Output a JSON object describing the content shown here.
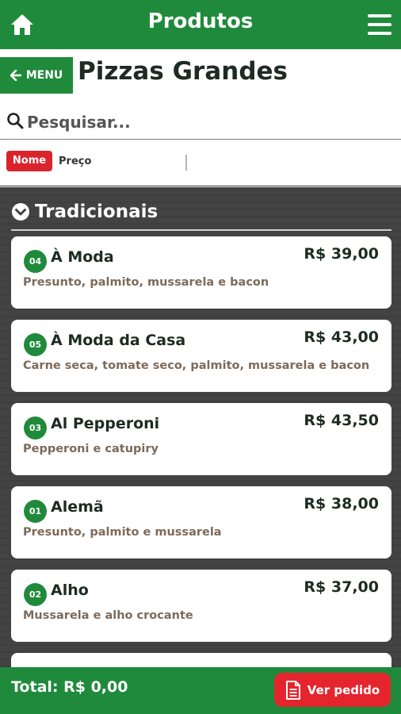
{
  "header": {
    "title": "Produtos",
    "home_icon": "home-icon",
    "menu_icon": "hamburger-menu-icon"
  },
  "nav": {
    "menu_button": "MENU",
    "page_title": "Pizzas Grandes"
  },
  "search": {
    "placeholder": "Pesquisar..."
  },
  "sort": {
    "name": "Nome",
    "price": "Preço"
  },
  "category": {
    "title": "Tradicionais"
  },
  "items": [
    {
      "code": "04",
      "name": "À Moda",
      "price": "R$ 39,00",
      "desc": "Presunto, palmito, mussarela e bacon"
    },
    {
      "code": "05",
      "name": "À Moda da Casa",
      "price": "R$ 43,00",
      "desc": "Carne seca, tomate seco, palmito, mussarela e bacon"
    },
    {
      "code": "03",
      "name": "Al Pepperoni",
      "price": "R$ 43,50",
      "desc": "Pepperoni e catupiry"
    },
    {
      "code": "01",
      "name": "Alemã",
      "price": "R$ 38,00",
      "desc": "Presunto, palmito e mussarela"
    },
    {
      "code": "02",
      "name": "Alho",
      "price": "R$ 37,00",
      "desc": "Mussarela e alho crocante"
    }
  ],
  "footer": {
    "total": "Total: R$ 0,00",
    "button": "Ver pedido"
  },
  "colors": {
    "brand_green": "#1f8a3b",
    "accent_red": "#e5252d"
  }
}
